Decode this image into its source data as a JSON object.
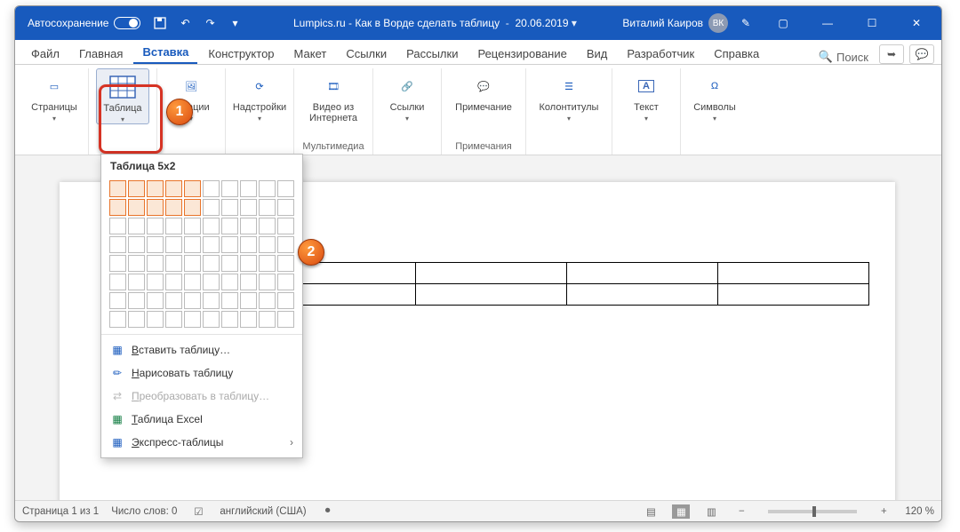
{
  "titlebar": {
    "autosave": "Автосохранение",
    "title_main": "Lumpics.ru - Как в Ворде сделать таблицу",
    "title_date": "20.06.2019",
    "username": "Виталий Каиров",
    "avatar": "ВК"
  },
  "tabs": {
    "file": "Файл",
    "home": "Главная",
    "insert": "Вставка",
    "constructor": "Конструктор",
    "layout": "Макет",
    "refs": "Ссылки",
    "mailings": "Рассылки",
    "review": "Рецензирование",
    "view": "Вид",
    "developer": "Разработчик",
    "help": "Справка",
    "search": "Поиск"
  },
  "ribbon": {
    "pages": "Страницы",
    "table": "Таблица",
    "illustrations": "страции",
    "addins": "Надстройки",
    "video": "Видео из Интернета",
    "media_grp": "Мультимедиа",
    "links": "Ссылки",
    "comment": "Примечание",
    "comments_grp": "Примечания",
    "headers": "Колонтитулы",
    "text": "Текст",
    "symbols": "Символы"
  },
  "dropdown": {
    "header": "Таблица 5x2",
    "cols_sel": 5,
    "rows_sel": 2,
    "insert_table": "Вставить таблицу…",
    "draw_table": "Нарисовать таблицу",
    "convert": "Преобразовать в таблицу…",
    "excel": "Таблица Excel",
    "quick": "Экспресс-таблицы"
  },
  "doc_table": {
    "rows": 2,
    "cols": 5
  },
  "status": {
    "page": "Страница 1 из 1",
    "words": "Число слов: 0",
    "lang": "английский (США)",
    "zoom": "120 %"
  },
  "markers": {
    "one": "1",
    "two": "2"
  }
}
